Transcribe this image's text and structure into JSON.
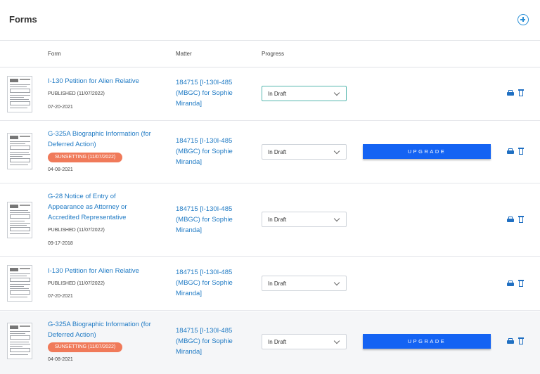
{
  "header": {
    "title": "Forms"
  },
  "columns": {
    "form": "Form",
    "matter": "Matter",
    "progress": "Progress"
  },
  "rows": [
    {
      "title": "I-130 Petition for Alien Relative",
      "status": "PUBLISHED (11/07/2022)",
      "date": "07-20-2021",
      "matter": "184715 [I-130I-485 (MBGC) for Sophie Miranda]",
      "progress": "In Draft"
    },
    {
      "title": "G-325A Biographic Information (for Deferred Action)",
      "badge": "SUNSETTING (11/07/2022)",
      "date": "04-08-2021",
      "matter": "184715 [I-130I-485 (MBGC) for Sophie Miranda]",
      "progress": "In Draft",
      "upgrade": "UPGRADE"
    },
    {
      "title": "G-28 Notice of Entry of Appearance as Attorney or Accredited Representative",
      "status": "PUBLISHED (11/07/2022)",
      "date": "09-17-2018",
      "matter": "184715 [I-130I-485 (MBGC) for Sophie Miranda]",
      "progress": "In Draft"
    },
    {
      "title": "I-130 Petition for Alien Relative",
      "status": "PUBLISHED (11/07/2022)",
      "date": "07-20-2021",
      "matter": "184715 [I-130I-485 (MBGC) for Sophie Miranda]",
      "progress": "In Draft"
    },
    {
      "title": "G-325A Biographic Information (for Deferred Action)",
      "badge": "SUNSETTING (11/07/2022)",
      "date": "04-08-2021",
      "matter": "184715 [I-130I-485 (MBGC) for Sophie Miranda]",
      "progress": "In Draft",
      "upgrade": "UPGRADE"
    }
  ],
  "colors": {
    "link": "#1f7ac4",
    "badge": "#f07a5a",
    "upgrade": "#1463f3",
    "icon": "#1f6fc2",
    "focus": "#55b6ae"
  },
  "icons": {
    "add": "plus-circle-icon",
    "print": "printer-icon",
    "delete": "trash-icon",
    "dropdown": "chevron-down-icon"
  }
}
